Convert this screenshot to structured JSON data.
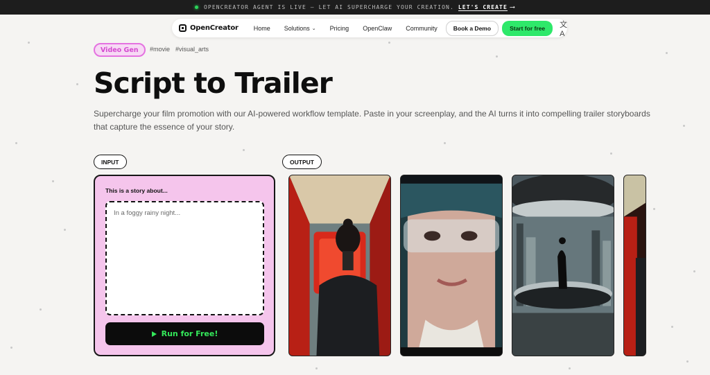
{
  "announcement": {
    "text": "OPENCREATOR AGENT IS LIVE — LET AI SUPERCHARGE YOUR CREATION.",
    "cta": "LET'S CREATE",
    "arrow": "⟶",
    "dot_color": "#2bd65a"
  },
  "nav": {
    "logo": "OpenCreator",
    "links": [
      {
        "label": "Home"
      },
      {
        "label": "Solutions",
        "icon": "chevron-down-icon"
      },
      {
        "label": "Pricing"
      },
      {
        "label": "OpenClaw"
      },
      {
        "label": "Community"
      }
    ],
    "book_demo": "Book a Demo",
    "start_free": "Start for free",
    "accent": "#2ee86a",
    "language_icon": "translate-icon"
  },
  "hero": {
    "category_tag": "Video Gen",
    "hashtags": [
      "#movie",
      "#visual_arts"
    ],
    "title": "Script to Trailer",
    "description": "Supercharge your film promotion with our AI-powered workflow template. Paste in your screenplay, and the AI turns it into compelling trailer storyboards that capture the essence of your story."
  },
  "input": {
    "pill": "INPUT",
    "label": "This is a story about...",
    "placeholder": "In a foggy rainy night...",
    "run_button": "Run for Free!",
    "card_color": "#f5c5ec",
    "button_text_color": "#34e85a"
  },
  "output": {
    "pill": "OUTPUT",
    "frames": [
      {
        "subject": "woman from behind in red-lit corridor"
      },
      {
        "subject": "close-up of woman wearing clear visor"
      },
      {
        "subject": "silhouette standing on futuristic platform"
      },
      {
        "subject": "partial red corridor frame"
      }
    ]
  }
}
